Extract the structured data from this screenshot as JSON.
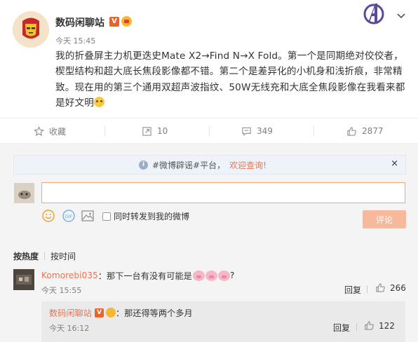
{
  "post": {
    "username": "数码闲聊站",
    "badge_v": "V",
    "time": "今天 15:45",
    "text": "我的折叠屏主力机更迭史Mate X2→Find N→X Fold。第一个是同期绝对佼佼者，楔型结构和超大底长焦段影像都不错。第二个是差异化的小机身和浅折痕，非常精致。现在用的第三个通用双超声波指纹、50W无线充和大底全焦段影像在我看来都是好文明"
  },
  "actions": {
    "favorite": "收藏",
    "repost": "10",
    "comment": "349",
    "like": "2877"
  },
  "notice": {
    "topic": "#微博辟谣#平台，",
    "link": "欢迎查询!",
    "close": "×"
  },
  "composer": {
    "input_value": "",
    "repost_label": "同时转发到我的微博",
    "submit": "评论",
    "gif_label": "GIF"
  },
  "sort": {
    "hot": "按热度",
    "time": "按时间"
  },
  "comments": [
    {
      "user": "Komorebi035",
      "text": "：那下一台有没有可能是",
      "suffix": "?",
      "time": "今天 15:55",
      "reply": "回复",
      "likes": "266"
    }
  ],
  "sub_comment": {
    "user": "数码闲聊站",
    "badge_v": "V",
    "text": "：那还得等两个多月",
    "time": "今天 16:12",
    "reply": "回复",
    "likes": "122"
  },
  "colors": {
    "accent": "#eb7350",
    "muted": "#808080",
    "submit_disabled": "#f7b89b"
  }
}
